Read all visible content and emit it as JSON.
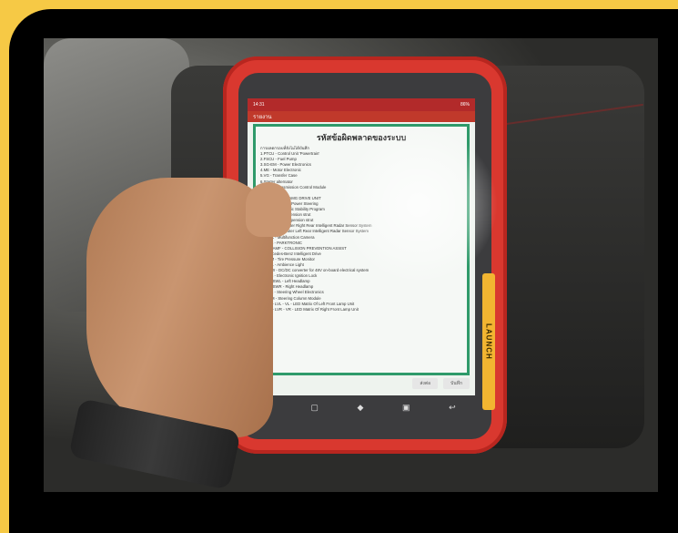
{
  "screen": {
    "status_time": "14:31",
    "status_right": "86%",
    "app_title": "รายงาน",
    "title": "รหัสข้อผิดพลาดของระบบ",
    "intro": "การผลตกรอบที่ยังไม่ได้บันทึก",
    "codes": [
      "1.PTCU - Control Unit 'Powertrain'",
      "2.FSCU - Fuel Pump",
      "3.SG-EM - Power Electronics",
      "4.ME - Motor Electronic",
      "5.VG - Transfer Case",
      "6.Starter alternator",
      "7.TCM - Transmission Control Module",
      "8.Suspension",
      "9.AWD DRIVE - AMG DRIVE UNIT",
      "10.ES - Electrical Power Steering",
      "11.ESP - Electronic Stability Program",
      "12.Left front suspension strut",
      "13.Right front suspension strut",
      "14.IRS-HRA - Outer Right Rear Intelligent Radar Sensor System",
      "15.IRS-HLA - Outer Left Rear Intelligent Radar Sensor System",
      "16.MFK - Multifunction Camera",
      "17.PTS - PARKTRONIC",
      "18.SG-AMF - COLLISION PREVENTION ASSIST",
      "19.Mercedes-Benz Intelligent Drive",
      "20.TPM - Tire Pressure Monitor",
      "21.AML - Ambience Light",
      "22.DDW - DC/DC converter for 48V on-board electrical system",
      "23.EZS - Electronic Ignition Lock",
      "24.SG-SWL - Left Headlamp",
      "25.SG-SWR - Right Headlamp",
      "26.LRE - Steering Wheel Electronics",
      "27.SCM - Steering Column Module",
      "28.SG - LVL - VL - LED Matrix Of Left Front Lamp Unit",
      "29.SG - LVR - VR - LED Matrix Of Right Front Lamp Unit"
    ],
    "buttons": [
      "ส่งต่อ",
      "บันทึก"
    ],
    "brand": "LAUNCH"
  }
}
